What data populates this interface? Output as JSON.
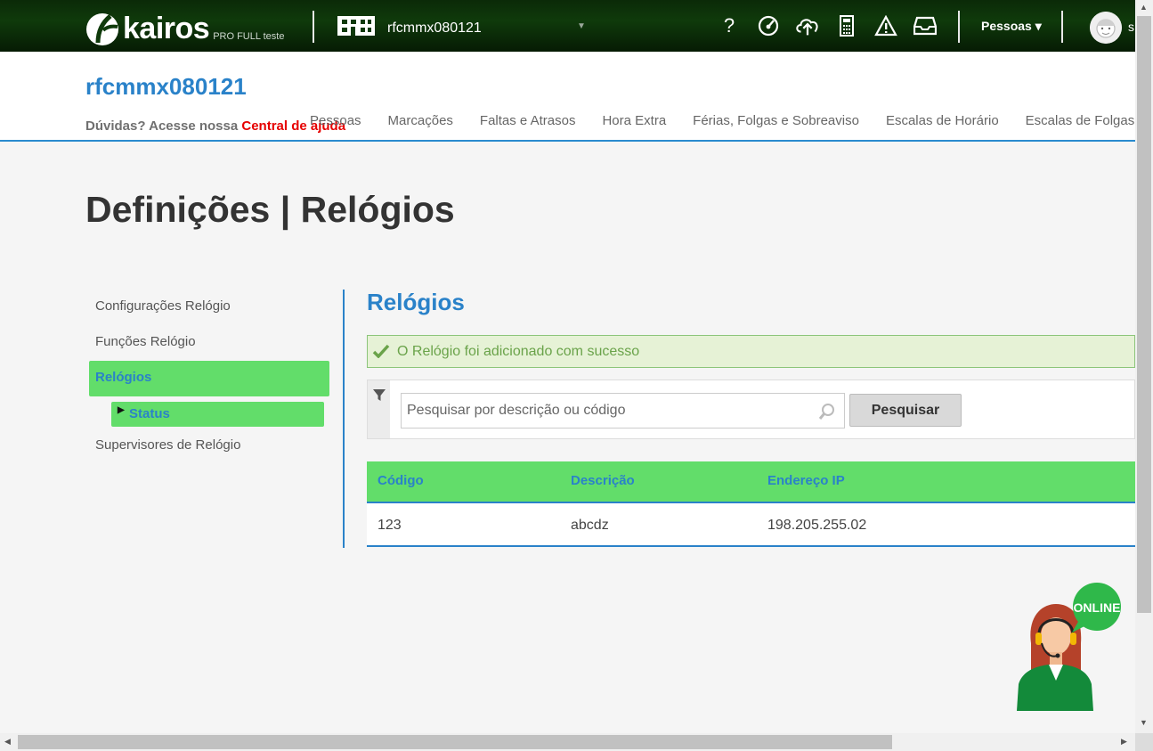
{
  "topbar": {
    "logo_text": "kairos",
    "logo_sub": "PRO FULL teste",
    "company_selector": "rfcmmx080121",
    "icons": [
      "help-icon",
      "speedometer-icon",
      "cloud-upload-icon",
      "calculator-icon",
      "warning-icon",
      "inbox-icon"
    ],
    "help_glyph": "?",
    "pessoas_menu": "Pessoas ▾",
    "user_initial": "s"
  },
  "header": {
    "company_title": "rfcmmx080121",
    "help_prefix": "Dúvidas? Acesse nossa ",
    "help_link": "Central de ajuda",
    "nav": [
      "Pessoas",
      "Marcações",
      "Faltas e Atrasos",
      "Hora Extra",
      "Férias, Folgas e Sobreaviso",
      "Escalas de Horário",
      "Escalas de Folgas"
    ]
  },
  "page_title": "Definições | Relógios",
  "sidebar": {
    "items": [
      "Configurações Relógio",
      "Funções Relógio",
      "Relógios"
    ],
    "active": "Relógios",
    "subitem": "Status",
    "last_item": "Supervisores de Relógio"
  },
  "content": {
    "title": "Relógios",
    "alert": "O Relógio foi adicionado com sucesso",
    "search_placeholder": "Pesquisar por descrição ou código",
    "search_button": "Pesquisar",
    "table": {
      "headers": [
        "Código",
        "Descrição",
        "Endereço IP"
      ],
      "rows": [
        [
          "123",
          "abcdz",
          "198.205.255.02"
        ]
      ]
    }
  },
  "chat_widget": {
    "badge": "ONLINE"
  },
  "colors": {
    "accent_blue": "#2a82c9",
    "accent_green": "#62dd6a",
    "help_red": "#e60000",
    "topbar": "#0f3a0b"
  }
}
